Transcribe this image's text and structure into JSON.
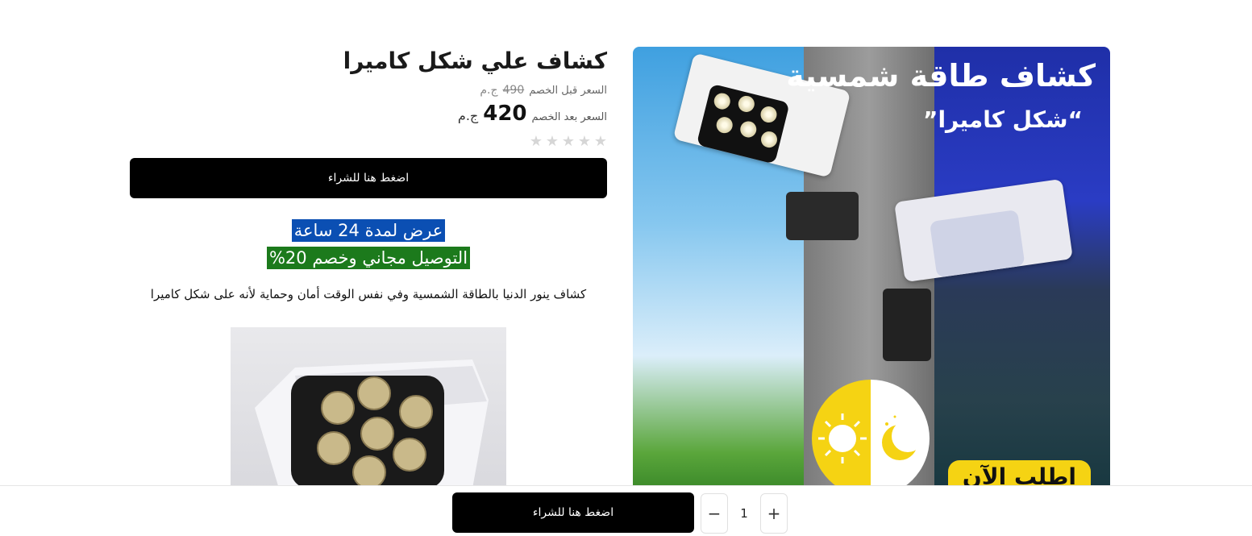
{
  "product": {
    "title": "كشاف علي شكل كاميرا",
    "old_price_label": "السعر قبل الخصم",
    "old_price": "490",
    "old_currency": "ج.م",
    "new_price_label": "السعر بعد الخصم",
    "new_price": "420",
    "new_currency": "ج.م",
    "rating": 0,
    "rating_max": 5,
    "buy_label": "اضغط هنا للشراء"
  },
  "promo": {
    "line1": "عرض لمدة 24 ساعة",
    "line2": "التوصيل مجاني وخصم 20%"
  },
  "description": "كشاف ينور الدنيا بالطاقة الشمسية وفي نفس الوقت أمان وحماية لأنه على شكل كاميرا",
  "hero": {
    "title": "كشاف طاقة شمسية",
    "subtitle": "“شكل كاميرا”",
    "badge": "اطلب الآن"
  },
  "sticky": {
    "buy_label": "اضغط هنا للشراء",
    "quantity": "1",
    "minus": "−",
    "plus": "+"
  },
  "colors": {
    "accent": "#000000",
    "promo_blue": "#0b4fb3",
    "promo_green": "#1c7a1c",
    "star_empty": "#d6d6d6"
  }
}
